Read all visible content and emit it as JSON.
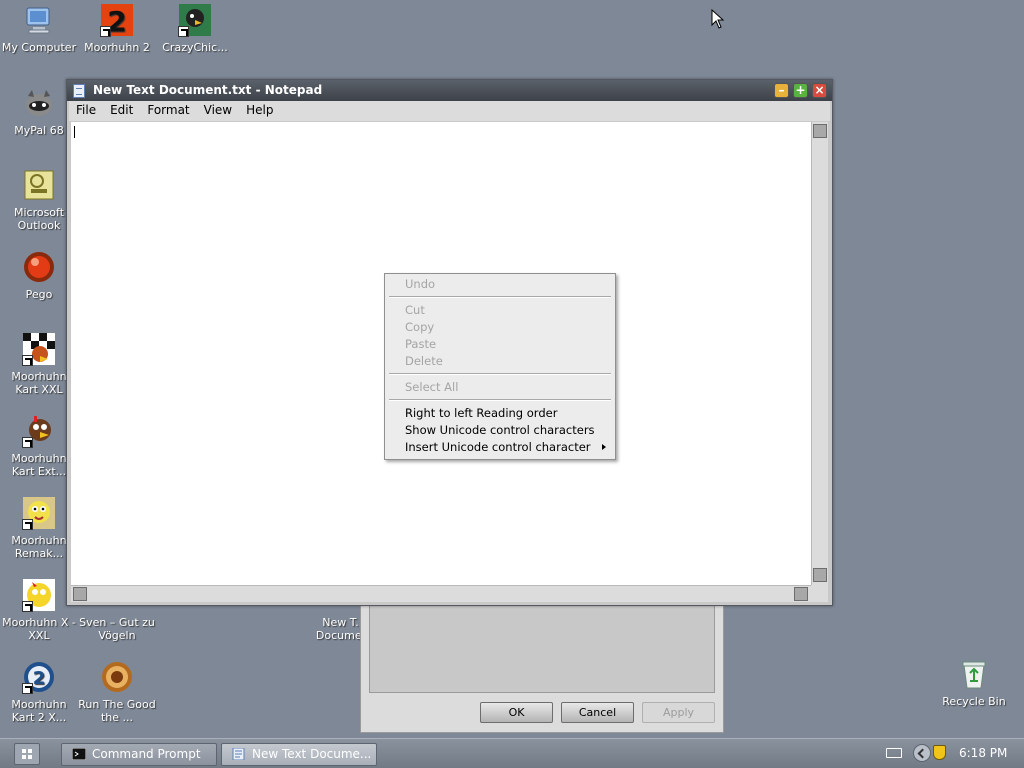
{
  "desktop": {
    "icons": [
      {
        "label": "My Computer"
      },
      {
        "label": "Moorhuhn 2"
      },
      {
        "label": "CrazyChic..."
      },
      {
        "label": "MyPal 68"
      },
      {
        "label": "Microsoft Outlook"
      },
      {
        "label": "Pego"
      },
      {
        "label": "Moorhuhn Kart XXL"
      },
      {
        "label": "Moorhuhn Kart Ext..."
      },
      {
        "label": "Moorhuhn Remak..."
      },
      {
        "label": "Moorhuhn X - XXL"
      },
      {
        "label": "Sven – Gut zu Vögeln"
      },
      {
        "label": "New T... Docume..."
      },
      {
        "label": "Moorhuhn Kart 2 X..."
      },
      {
        "label": "Run The Good the ..."
      },
      {
        "label": "Recycle Bin"
      }
    ]
  },
  "background_dialog": {
    "ok_label": "OK",
    "cancel_label": "Cancel",
    "apply_label": "Apply"
  },
  "notepad": {
    "title": "New Text Document.txt - Notepad",
    "menu": [
      "File",
      "Edit",
      "Format",
      "View",
      "Help"
    ],
    "content": ""
  },
  "context_menu": {
    "items": [
      {
        "label": "Undo",
        "enabled": false
      },
      {
        "label": "Cut",
        "enabled": false
      },
      {
        "label": "Copy",
        "enabled": false
      },
      {
        "label": "Paste",
        "enabled": false
      },
      {
        "label": "Delete",
        "enabled": false
      },
      {
        "label": "Select All",
        "enabled": false
      },
      {
        "label": "Right to left Reading order",
        "enabled": true
      },
      {
        "label": "Show Unicode control characters",
        "enabled": true
      },
      {
        "label": "Insert Unicode control character",
        "enabled": true
      }
    ]
  },
  "taskbar": {
    "tasks": [
      {
        "label": "Command Prompt",
        "icon": "command-prompt-icon"
      },
      {
        "label": "New Text Docume...",
        "icon": "notepad-icon"
      }
    ],
    "clock": "6:18 PM"
  },
  "colors": {
    "desktop": "#7e8896",
    "titlebar": "#4a5058",
    "menu_bg": "#ececec",
    "disabled_text": "#a4a4a4"
  }
}
